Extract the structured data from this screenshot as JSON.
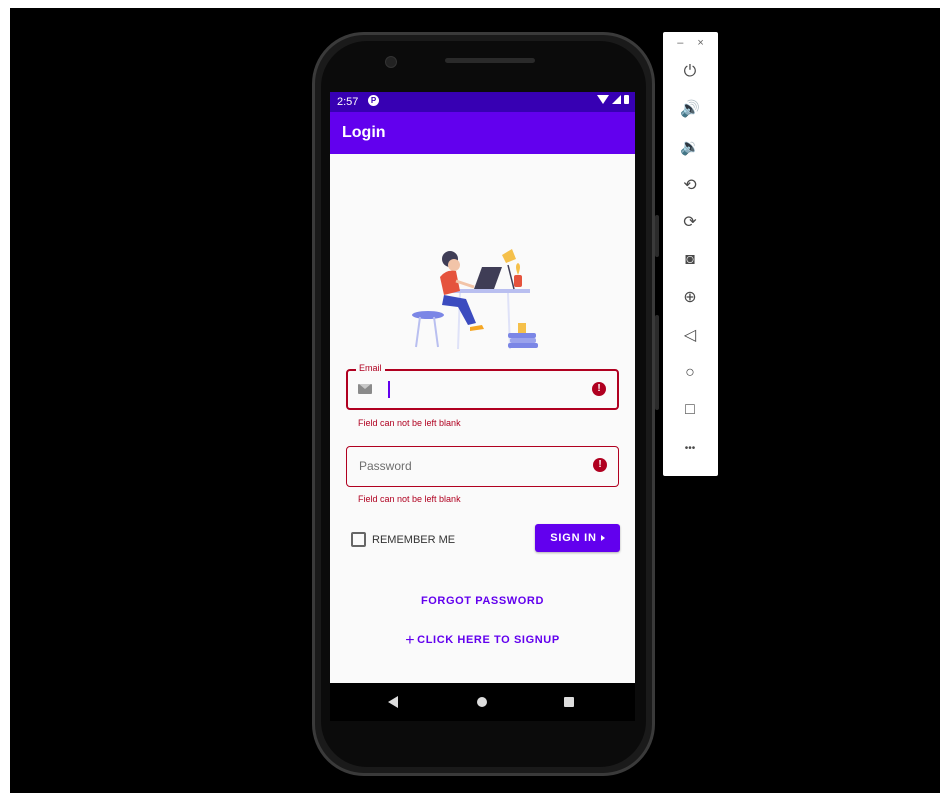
{
  "status_bar": {
    "time": "2:57",
    "app_icon": "P"
  },
  "app_bar": {
    "title": "Login"
  },
  "email_field": {
    "label": "Email",
    "value": "",
    "error": "Field can not be left blank",
    "icon": "mail-icon",
    "error_icon": "!"
  },
  "password_field": {
    "placeholder": "Password",
    "error": "Field can not be left blank",
    "error_icon": "!"
  },
  "remember_me": {
    "label": "REMEMBER ME",
    "checked": false
  },
  "sign_in": {
    "label": "SIGN IN"
  },
  "forgot_password": {
    "label": "FORGOT PASSWORD"
  },
  "signup": {
    "plus": "+",
    "label": "CLICK HERE TO SIGNUP"
  },
  "emulator_toolbar": {
    "minimize": "–",
    "close": "×",
    "buttons": [
      {
        "icon": "power-icon",
        "glyph": "⏻"
      },
      {
        "icon": "volume-up-icon",
        "glyph": "🔊"
      },
      {
        "icon": "volume-down-icon",
        "glyph": "🔉"
      },
      {
        "icon": "rotate-left-icon",
        "glyph": "⟲"
      },
      {
        "icon": "rotate-right-icon",
        "glyph": "⟳"
      },
      {
        "icon": "camera-icon",
        "glyph": "◙"
      },
      {
        "icon": "zoom-icon",
        "glyph": "⊕"
      },
      {
        "icon": "back-icon",
        "glyph": "◁"
      },
      {
        "icon": "home-icon",
        "glyph": "○"
      },
      {
        "icon": "overview-icon",
        "glyph": "□"
      },
      {
        "icon": "more-icon",
        "glyph": "•••"
      }
    ]
  },
  "colors": {
    "primary": "#6200ee",
    "primary_dark": "#3700b3",
    "error": "#b00020",
    "background": "#fafafa"
  }
}
